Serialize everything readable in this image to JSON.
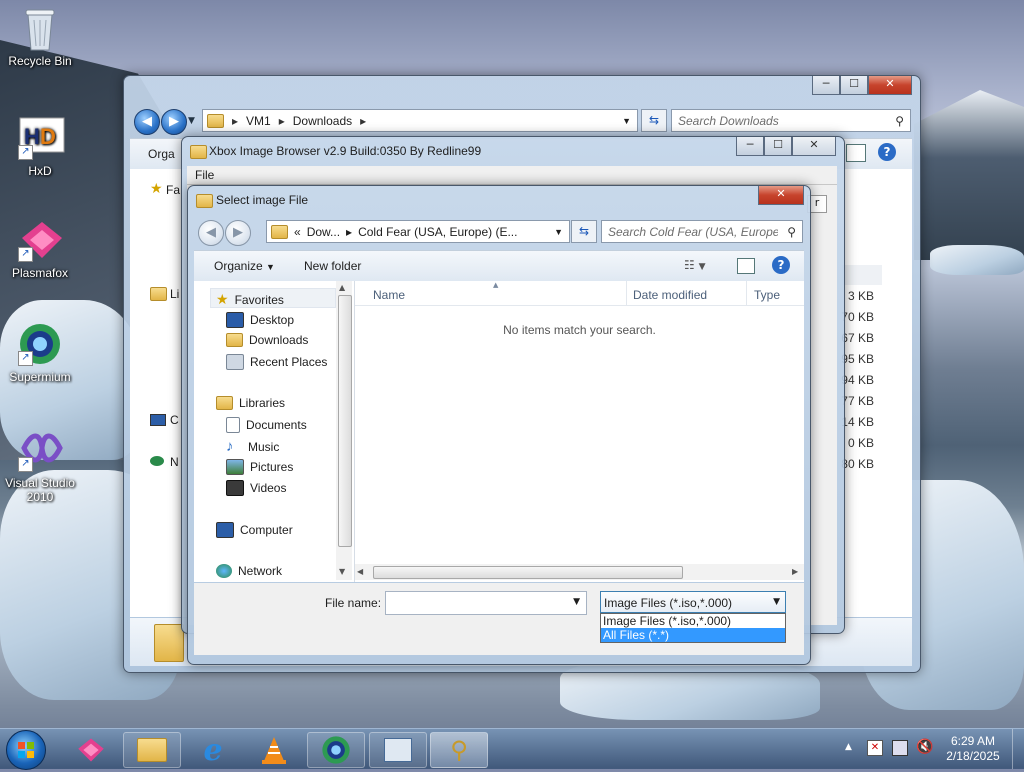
{
  "desktop": {
    "icons": [
      {
        "label": "Recycle Bin"
      },
      {
        "label": "HxD"
      },
      {
        "label": "Plasmafox"
      },
      {
        "label": "Supermium"
      },
      {
        "label": "Visual Studio 2010"
      }
    ]
  },
  "explorer": {
    "address": {
      "segments": [
        "VM1",
        "Downloads"
      ]
    },
    "search_placeholder": "Search Downloads",
    "toolbar_partial": "Orga",
    "sidebar_partial": [
      "Fa",
      "Li",
      "C",
      "N"
    ],
    "sizes": [
      "3 KB",
      "70 KB",
      "67 KB",
      "95 KB",
      "94 KB",
      "77 KB",
      "14 KB",
      "0 KB",
      "80 KB"
    ],
    "buttons": {
      "minimize": "─",
      "maximize": "☐",
      "close": "✕"
    }
  },
  "xbox_browser": {
    "title": "Xbox Image Browser v2.9 Build:0350 By Redline99",
    "menu": {
      "file": "File"
    },
    "partial_col": "r"
  },
  "dialog": {
    "title": "Select image File",
    "address": {
      "prefix": "«",
      "segments": [
        "Dow...",
        "Cold Fear (USA, Europe) (E..."
      ]
    },
    "search_placeholder": "Search Cold Fear (USA, Europe...",
    "toolbar": {
      "organize": "Organize",
      "new_folder": "New folder"
    },
    "tree": {
      "favorites": "Favorites",
      "favorites_items": [
        "Desktop",
        "Downloads",
        "Recent Places"
      ],
      "libraries": "Libraries",
      "library_items": [
        "Documents",
        "Music",
        "Pictures",
        "Videos"
      ],
      "computer": "Computer",
      "network": "Network"
    },
    "columns": {
      "name": "Name",
      "date_modified": "Date modified",
      "type": "Type"
    },
    "empty_message": "No items match your search.",
    "file_name_label": "File name:",
    "file_name_value": "",
    "filter_selected": "Image Files (*.iso,*.000)",
    "filter_options": [
      "Image Files (*.iso,*.000)",
      "All Files (*.*)"
    ]
  },
  "taskbar": {
    "time": "6:29 AM",
    "date": "2/18/2025"
  },
  "colors": {
    "selection": "#3399ff",
    "close_button": "#c7442d",
    "link_blue": "#1a57b8"
  }
}
